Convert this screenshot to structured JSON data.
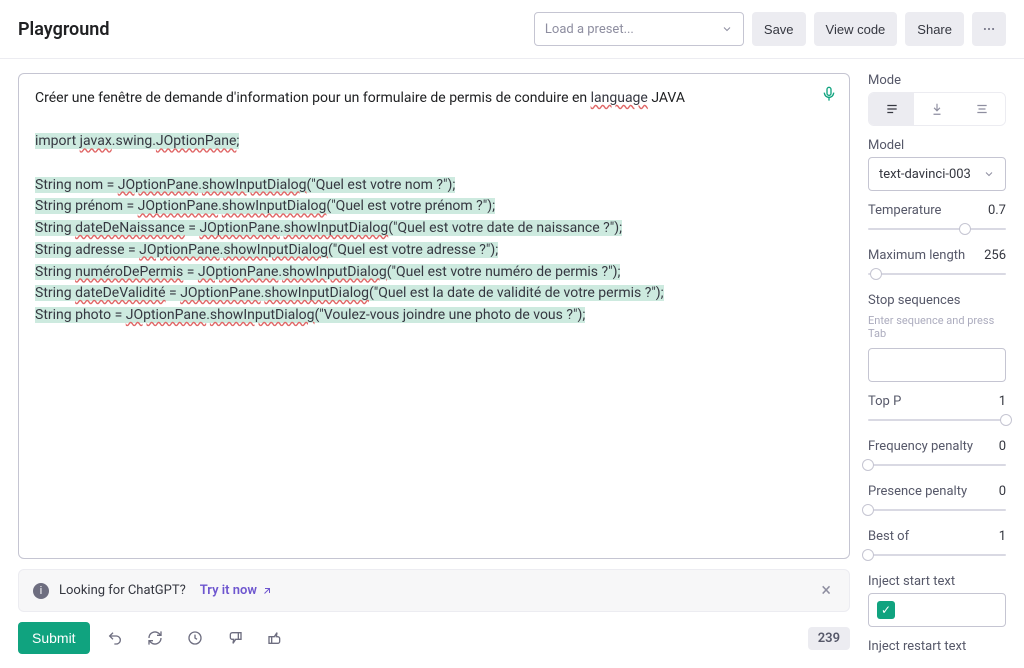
{
  "header": {
    "title": "Playground",
    "preset_placeholder": "Load a preset...",
    "save": "Save",
    "view_code": "View code",
    "share": "Share"
  },
  "editor": {
    "lines": [
      {
        "segments": [
          {
            "t": "Créer une fenêtre de demande d'information pour un formulaire de permis de conduire en "
          },
          {
            "t": "language",
            "cls": "ul-red"
          },
          {
            "t": " JAVA"
          }
        ]
      },
      {
        "segments": []
      },
      {
        "segments": [
          {
            "t": "import ",
            "cls": "hl"
          },
          {
            "t": "javax",
            "cls": "hl ul-red"
          },
          {
            "t": ".swing.",
            "cls": "hl"
          },
          {
            "t": "JOptionPane",
            "cls": "hl ul-red"
          },
          {
            "t": ";",
            "cls": "hl"
          }
        ]
      },
      {
        "segments": []
      },
      {
        "segments": [
          {
            "t": "String nom = ",
            "cls": "hl"
          },
          {
            "t": "JOptionPane",
            "cls": "hl ul-red"
          },
          {
            "t": ".",
            "cls": "hl"
          },
          {
            "t": "showInputDialog",
            "cls": "hl ul-red"
          },
          {
            "t": "(\"Quel est votre nom ?\");",
            "cls": "hl"
          }
        ]
      },
      {
        "segments": [
          {
            "t": "String prénom = ",
            "cls": "hl"
          },
          {
            "t": "JOptionPane",
            "cls": "hl ul-red"
          },
          {
            "t": ".",
            "cls": "hl"
          },
          {
            "t": "showInputDialog",
            "cls": "hl ul-red"
          },
          {
            "t": "(\"Quel est votre prénom ?\");",
            "cls": "hl"
          }
        ]
      },
      {
        "segments": [
          {
            "t": "String ",
            "cls": "hl"
          },
          {
            "t": "dateDeNaissance",
            "cls": "hl ul-red"
          },
          {
            "t": " = ",
            "cls": "hl"
          },
          {
            "t": "JOptionPane",
            "cls": "hl ul-red"
          },
          {
            "t": ".",
            "cls": "hl"
          },
          {
            "t": "showInputDialog",
            "cls": "hl ul-red"
          },
          {
            "t": "(\"Quel est votre date de naissance ?\");",
            "cls": "hl"
          }
        ]
      },
      {
        "segments": [
          {
            "t": "String adresse = ",
            "cls": "hl"
          },
          {
            "t": "JOptionPane",
            "cls": "hl ul-red"
          },
          {
            "t": ".",
            "cls": "hl"
          },
          {
            "t": "showInputDialog",
            "cls": "hl ul-red"
          },
          {
            "t": "(\"Quel est votre adresse ?\");",
            "cls": "hl"
          }
        ]
      },
      {
        "segments": [
          {
            "t": "String ",
            "cls": "hl"
          },
          {
            "t": "numéroDePermis",
            "cls": "hl ul-red"
          },
          {
            "t": " = ",
            "cls": "hl"
          },
          {
            "t": "JOptionPane",
            "cls": "hl ul-red"
          },
          {
            "t": ".",
            "cls": "hl"
          },
          {
            "t": "showInputDialog",
            "cls": "hl ul-red"
          },
          {
            "t": "(\"Quel est votre numéro de permis ?\");",
            "cls": "hl"
          }
        ]
      },
      {
        "segments": [
          {
            "t": "String ",
            "cls": "hl"
          },
          {
            "t": "dateDeValidité",
            "cls": "hl ul-red"
          },
          {
            "t": " = ",
            "cls": "hl"
          },
          {
            "t": "JOptionPane",
            "cls": "hl ul-red"
          },
          {
            "t": ".",
            "cls": "hl"
          },
          {
            "t": "showInputDialog",
            "cls": "hl ul-red"
          },
          {
            "t": "(\"Quel est la date de validité de votre permis ?\");",
            "cls": "hl"
          }
        ]
      },
      {
        "segments": [
          {
            "t": "String photo = ",
            "cls": "hl"
          },
          {
            "t": "JOptionPane",
            "cls": "hl ul-red"
          },
          {
            "t": ".",
            "cls": "hl"
          },
          {
            "t": "showInputDialog",
            "cls": "hl ul-red"
          },
          {
            "t": "(\"Voulez-vous joindre une photo de vous ?\");",
            "cls": "hl"
          }
        ]
      }
    ]
  },
  "banner": {
    "text": "Looking for ChatGPT?",
    "link": "Try it now"
  },
  "bottom": {
    "submit": "Submit",
    "token_count": "239"
  },
  "sidebar": {
    "mode_label": "Mode",
    "model_label": "Model",
    "model_value": "text-davinci-003",
    "params": {
      "temperature": {
        "label": "Temperature",
        "value": "0.7",
        "pos": 70
      },
      "max_length": {
        "label": "Maximum length",
        "value": "256",
        "pos": 6
      },
      "top_p": {
        "label": "Top P",
        "value": "1",
        "pos": 100
      },
      "freq_penalty": {
        "label": "Frequency penalty",
        "value": "0",
        "pos": 0
      },
      "pres_penalty": {
        "label": "Presence penalty",
        "value": "0",
        "pos": 0
      },
      "best_of": {
        "label": "Best of",
        "value": "1",
        "pos": 0
      }
    },
    "stop_seq": {
      "label": "Stop sequences",
      "hint": "Enter sequence and press Tab"
    },
    "inject_start": "Inject start text",
    "inject_restart": "Inject restart text"
  }
}
